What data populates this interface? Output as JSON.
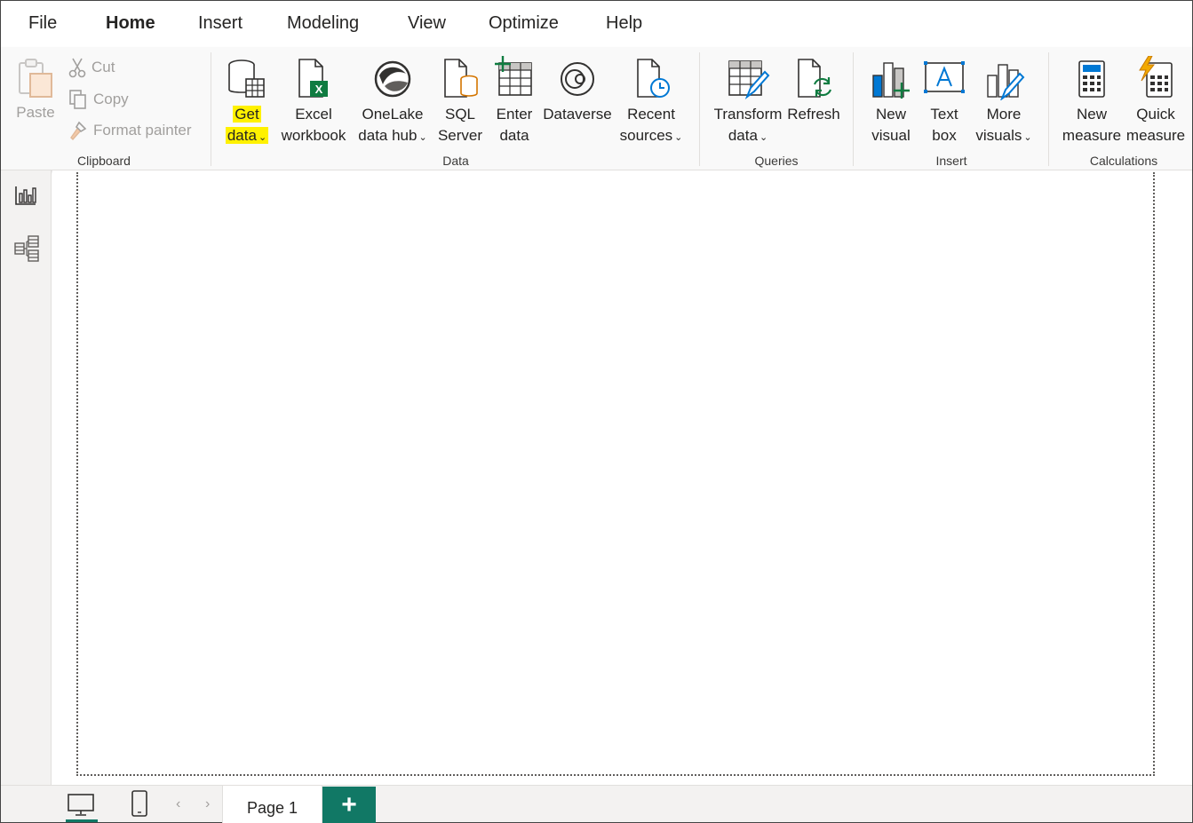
{
  "menu": {
    "tabs": [
      {
        "label": "File"
      },
      {
        "label": "Home",
        "active": true
      },
      {
        "label": "Insert"
      },
      {
        "label": "Modeling"
      },
      {
        "label": "View"
      },
      {
        "label": "Optimize"
      },
      {
        "label": "Help"
      }
    ]
  },
  "ribbon": {
    "clipboard": {
      "label": "Clipboard",
      "paste": "Paste",
      "cut": "Cut",
      "copy": "Copy",
      "format_painter": "Format painter"
    },
    "data": {
      "label": "Data",
      "get_data": [
        "Get",
        "data"
      ],
      "excel": [
        "Excel",
        "workbook"
      ],
      "onelake": [
        "OneLake",
        "data hub"
      ],
      "sql": [
        "SQL",
        "Server"
      ],
      "enter_data": [
        "Enter",
        "data"
      ],
      "dataverse": "Dataverse",
      "recent": [
        "Recent",
        "sources"
      ]
    },
    "queries": {
      "label": "Queries",
      "transform": [
        "Transform",
        "data"
      ],
      "refresh": "Refresh"
    },
    "insert": {
      "label": "Insert",
      "new_visual": [
        "New",
        "visual"
      ],
      "text_box": [
        "Text",
        "box"
      ],
      "more_visuals": [
        "More",
        "visuals"
      ]
    },
    "calculations": {
      "label": "Calculations",
      "new_measure": [
        "New",
        "measure"
      ],
      "quick_measure": [
        "Quick",
        "measure"
      ]
    }
  },
  "bottom": {
    "page_tab": "Page 1",
    "add_page": "+",
    "prev": "‹",
    "next": "›"
  },
  "colors": {
    "accent_green": "#117865",
    "highlight": "#fff100",
    "disabled": "#a19f9d"
  }
}
